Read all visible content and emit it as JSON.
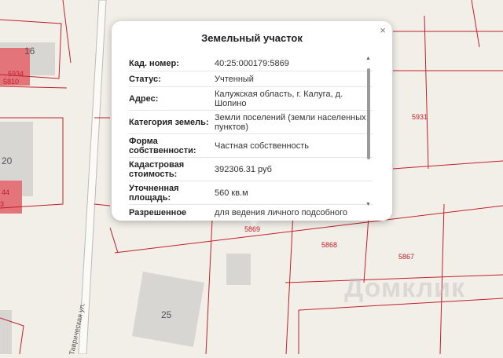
{
  "popup": {
    "title": "Земельный участок",
    "close": "×",
    "rows": [
      {
        "label": "Кад. номер:",
        "value": "40:25:000179:5869"
      },
      {
        "label": "Статус:",
        "value": "Учтенный"
      },
      {
        "label": "Адрес:",
        "value": "Калужская область, г. Калуга, д. Шопино"
      },
      {
        "label": "Категория земель:",
        "value": "Земли поселений (земли населенных пунктов)"
      },
      {
        "label": "Форма собственности:",
        "value": "Частная собственность"
      },
      {
        "label": "Кадастровая стоимость:",
        "value": "392306.31 руб"
      },
      {
        "label": "Уточненная площадь:",
        "value": "560 кв.м"
      },
      {
        "label": "Разрешенное",
        "value": "для ведения личного подсобного"
      }
    ],
    "scroll_up": "▲",
    "scroll_down": "▼"
  },
  "map": {
    "parcel_labels": [
      "5934",
      "5810",
      "5931",
      "5869",
      "5868",
      "5867",
      "44",
      "3"
    ],
    "house_numbers": [
      "16",
      "20",
      "25"
    ],
    "street": "Таврическая ул.",
    "watermark": "Домклик",
    "parcel_color": "#c0202a",
    "building_color": "#d8d6d2",
    "highlight_building_color": "#e2747a"
  }
}
